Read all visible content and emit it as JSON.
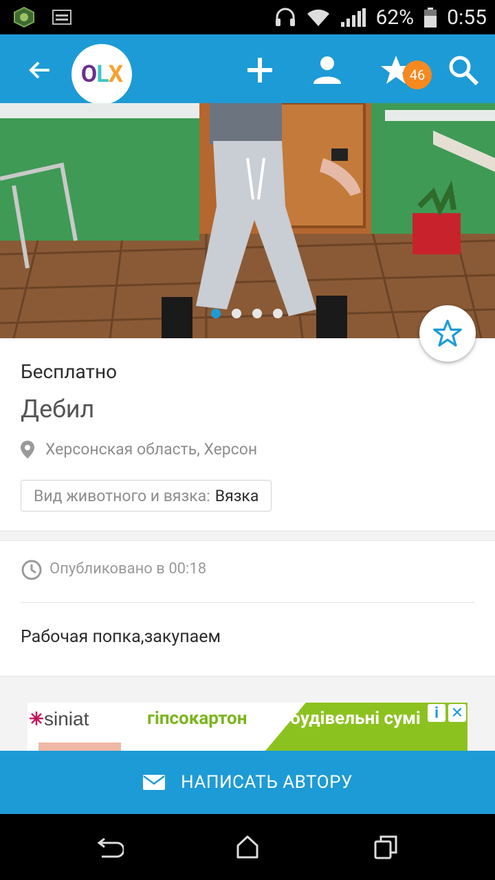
{
  "status_bar": {
    "battery": "62%",
    "time": "0:55"
  },
  "app_bar": {
    "logo": {
      "o": "O",
      "l": "L",
      "x": "X"
    },
    "favorites_count": "46",
    "icons": [
      "back-arrow-icon",
      "add-icon",
      "account-icon",
      "star-icon",
      "search-icon"
    ]
  },
  "gallery": {
    "dots": 4,
    "active_dot": 1
  },
  "listing": {
    "price": "Бесплатно",
    "title": "Дебил",
    "location": "Херсонская область, Херсон",
    "param_label": "Вид животного и вязка:",
    "param_value": "Вязка"
  },
  "details": {
    "published": "Опубликовано в 00:18",
    "description": "Рабочая попка,закупаем"
  },
  "ad": {
    "brand": "siniat",
    "product": "гіпсокартон",
    "headline": "будівельні сумі",
    "info_icon": "i",
    "close_icon": "✕"
  },
  "cta": {
    "label": "НАПИСАТЬ АВТОРУ"
  },
  "colors": {
    "accent": "#1d9bd6",
    "badge": "#f7891f"
  }
}
